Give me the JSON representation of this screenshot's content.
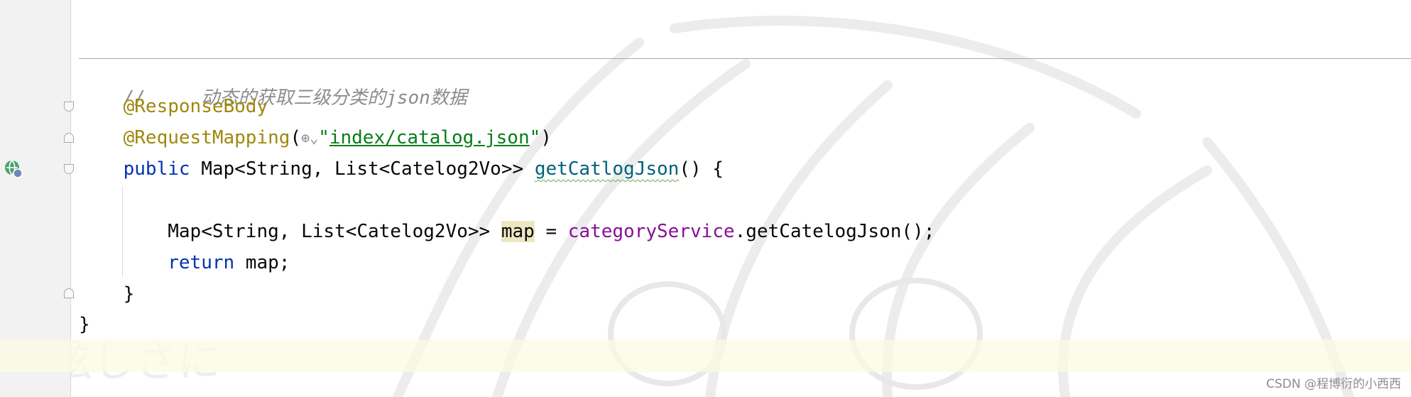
{
  "watermark": "CSDN @程博衍的小西西",
  "code_lines": {
    "l1": {
      "comment": "//     动态的获取三级分类的json数据"
    },
    "l2": {
      "annotation": "@ResponseBody"
    },
    "l3": {
      "annotation": "@RequestMapping",
      "open": "(",
      "quote_open": "\"",
      "path": "index/catalog.json",
      "quote_close": "\"",
      "close": ")"
    },
    "l4": {
      "kw_public": "public",
      "type": " Map<String, List<Catelog2Vo>> ",
      "method": "getCatlogJson",
      "rest": "() {"
    },
    "l6": {
      "type": "Map<String, List<Catelog2Vo>> ",
      "var": "map",
      "assign": " = ",
      "service": "categoryService",
      "call": ".getCatelogJson();"
    },
    "l7": {
      "kw_return": "return",
      "rest": " map;"
    },
    "l8": {
      "brace": "}"
    },
    "l9": {
      "brace": "}"
    }
  },
  "icons": {
    "globe": "globe-icon",
    "endpoint": "web-endpoint-gutter-icon",
    "fold": "fold-marker-icon"
  },
  "colors": {
    "keyword": "#0033b3",
    "annotation": "#9e880d",
    "method": "#00627a",
    "field": "#871094",
    "string": "#067d17",
    "comment": "#8c8c8c"
  }
}
